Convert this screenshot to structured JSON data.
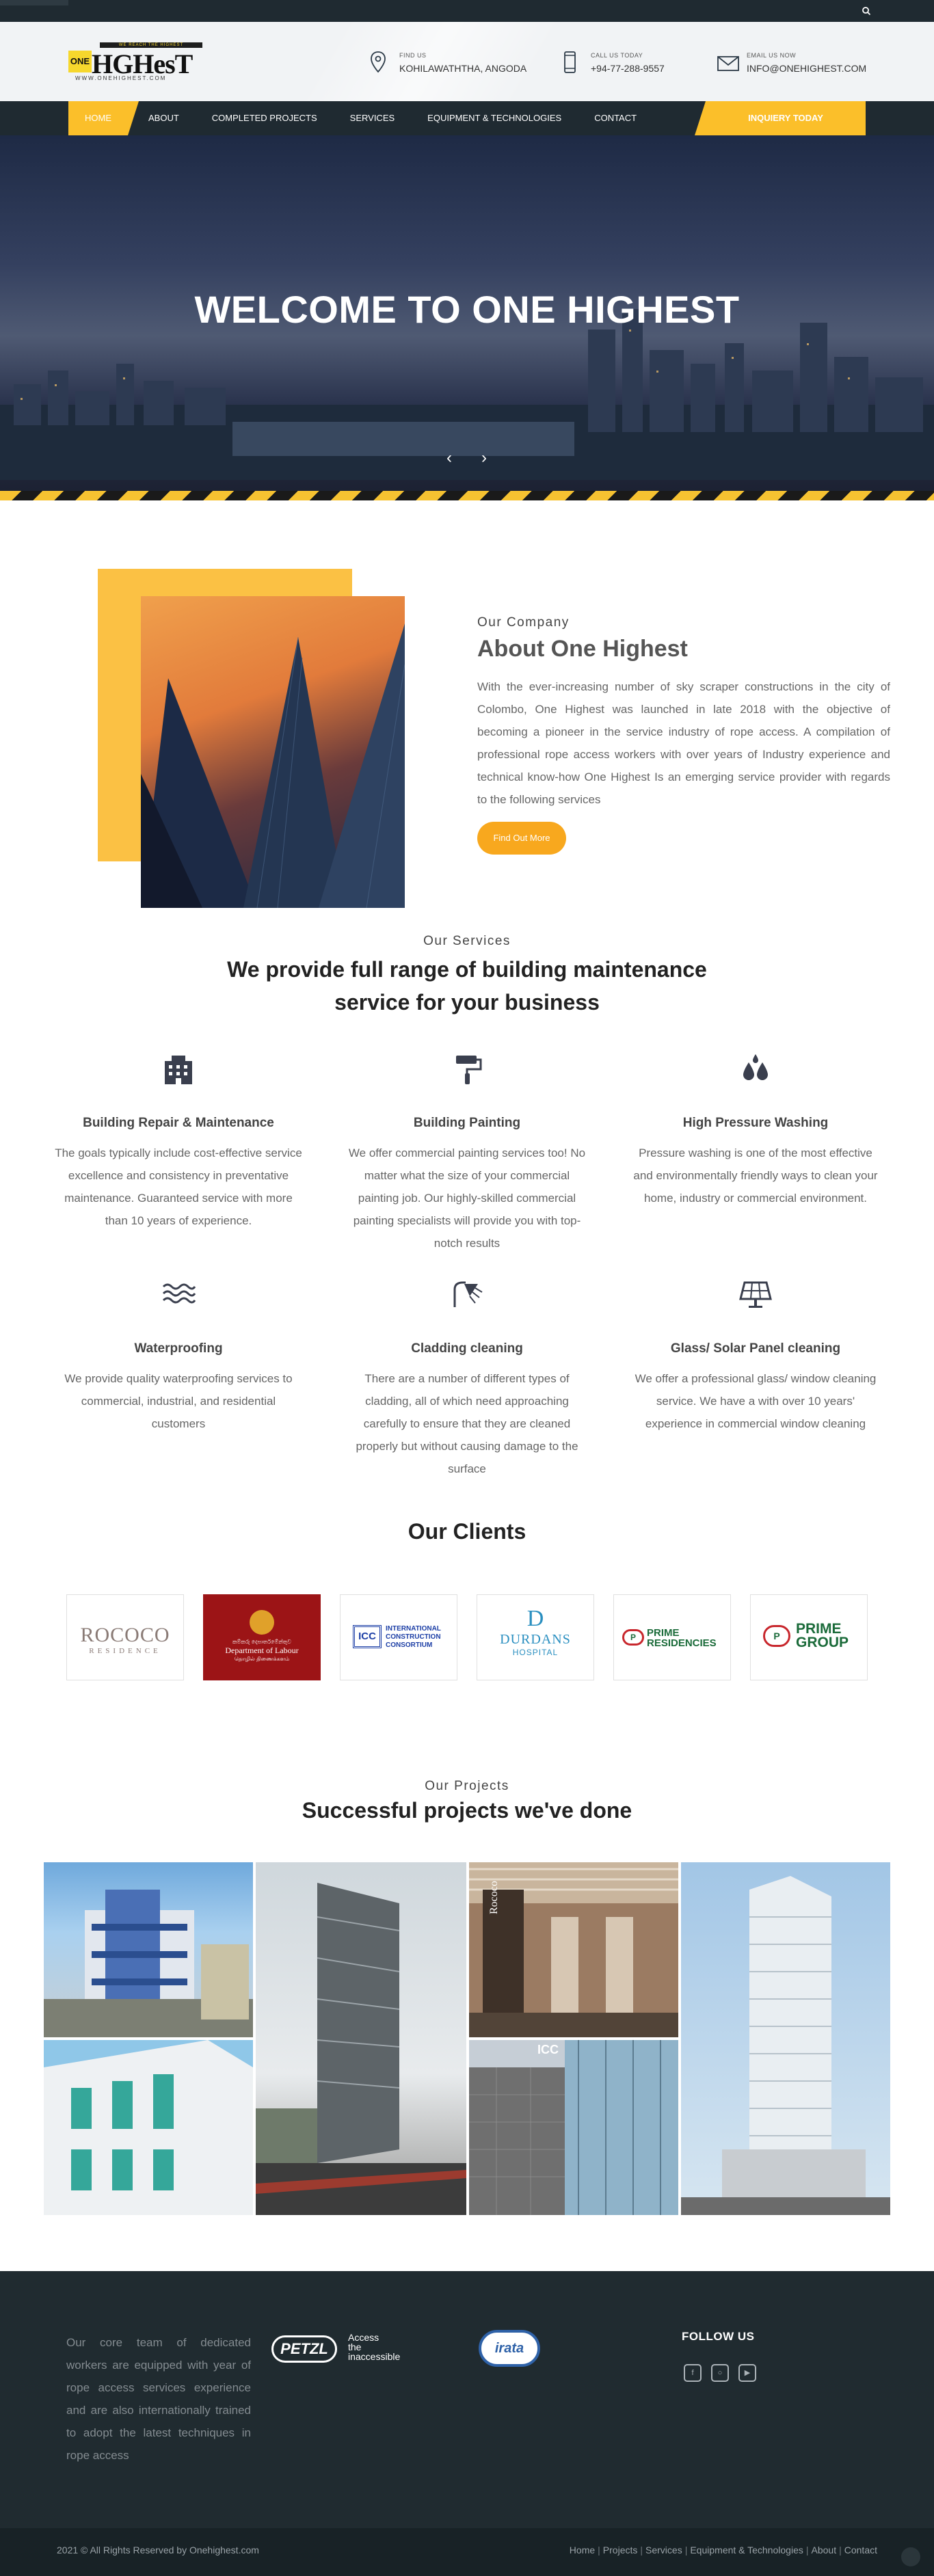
{
  "topbar": {
    "search_icon": "search-icon"
  },
  "header": {
    "logo": {
      "tagline": "WE REACH THE HIGHEST",
      "one": "ONE",
      "word": "HGHesT",
      "website": "WWW.ONEHIGHEST.COM"
    },
    "find": {
      "label": "FIND US",
      "value": "KOHILAWATHTHA, ANGODA",
      "icon": "location-pin-icon"
    },
    "call": {
      "label": "CALL US TODAY",
      "value": "+94-77-288-9557",
      "icon": "mobile-phone-icon"
    },
    "email": {
      "label": "EMAIL US NOW",
      "value": "INFO@ONEHIGHEST.COM",
      "icon": "envelope-icon"
    }
  },
  "nav": {
    "items": [
      "HOME",
      "ABOUT",
      "COMPLETED PROJECTS",
      "SERVICES",
      "EQUIPMENT & TECHNOLOGIES",
      "CONTACT"
    ],
    "active": "HOME",
    "inquiry": "INQUIERY TODAY",
    "accent": "#fbbf2a",
    "bg": "#1f2a31"
  },
  "hero": {
    "title": "WELCOME TO ONE HIGHEST",
    "prev_icon": "chevron-left-icon",
    "next_icon": "chevron-right-icon"
  },
  "about": {
    "subtitle": "Our Company",
    "title": "About One Highest",
    "body": "With the ever-increasing number of sky scraper constructions in the city of Colombo, One Highest was launched in late 2018 with the objective of becoming a pioneer in the service industry of rope access. A compilation of professional rope access workers with over years of Industry experience and technical know-how One Highest Is an emerging service provider with regards to the following services",
    "button": "Find Out More",
    "button_color": "#f8a81e"
  },
  "services": {
    "subtitle": "Our Services",
    "title_line1": "We provide full range of building maintenance",
    "title_line2": "service for your business",
    "items": [
      {
        "icon": "building-icon",
        "title": "Building Repair & Maintenance",
        "text": "The goals typically include cost-effective service excellence and consistency in preventative maintenance. Guaranteed service with more than 10 years of experience."
      },
      {
        "icon": "paint-roller-icon",
        "title": "Building Painting",
        "text": "We offer commercial painting services too! No matter what the size of your commercial painting job. Our highly-skilled commercial painting specialists will provide you with top-notch results"
      },
      {
        "icon": "water-drops-icon",
        "title": "High Pressure Washing",
        "text": "Pressure washing is one of the most effective and environmentally friendly ways to clean your home, industry or commercial environment."
      },
      {
        "icon": "waves-icon",
        "title": "Waterproofing",
        "text": "We provide quality waterproofing services to commercial, industrial, and residential customers"
      },
      {
        "icon": "shower-icon",
        "title": "Cladding cleaning",
        "text": "There are a number of different types of cladding, all of which need approaching carefully to ensure that they are cleaned properly but without causing damage to the surface"
      },
      {
        "icon": "solar-panel-icon",
        "title": "Glass/ Solar Panel cleaning",
        "text": "We offer a professional glass/ window cleaning service. We have a with over 10 years' experience in commercial window cleaning"
      }
    ]
  },
  "clients": {
    "title": "Our Clients",
    "logos": [
      {
        "name": "Rococo",
        "line1": "ROCOCO",
        "line2": "RESIDENCE"
      },
      {
        "name": "Department of Labour",
        "line1": "කම්කරු දෙපාර්තමේන්තුව",
        "line2": "Department of Labour",
        "line3": "தொழில் திணைக்களம்"
      },
      {
        "name": "ICC",
        "line1": "ICC",
        "line2": "INTERNATIONAL",
        "line3": "CONSTRUCTION",
        "line4": "CONSORTIUM"
      },
      {
        "name": "Durdans",
        "line1": "D",
        "line2": "DURDANS",
        "line3": "HOSPITAL"
      },
      {
        "name": "Prime Residencies",
        "line1": "PRIME",
        "line2": "RESIDENCIES"
      },
      {
        "name": "Prime Group",
        "line1": "PRIME",
        "line2": "GROUP"
      }
    ]
  },
  "projects": {
    "subtitle": "Our Projects",
    "title": "Successful projects we've done",
    "sign1": "Rococo",
    "sign2": "ICC"
  },
  "footer": {
    "about": "Our core team of dedicated workers are equipped with year of rope access services experience and are also internationally trained to adopt the latest techniques in rope access",
    "petzl": "PETZL",
    "petzl_tag1": "Access",
    "petzl_tag2": "the",
    "petzl_tag3": "inaccessible",
    "irata": "irata",
    "follow": "FOLLOW US",
    "social": [
      "facebook-icon",
      "instagram-icon",
      "youtube-icon"
    ]
  },
  "bottom": {
    "copyright": "2021 © All Rights Reserved by Onehighest.com",
    "links": [
      "Home",
      "Projects",
      "Services",
      "Equipment & Technologies",
      "About",
      "Contact"
    ]
  }
}
